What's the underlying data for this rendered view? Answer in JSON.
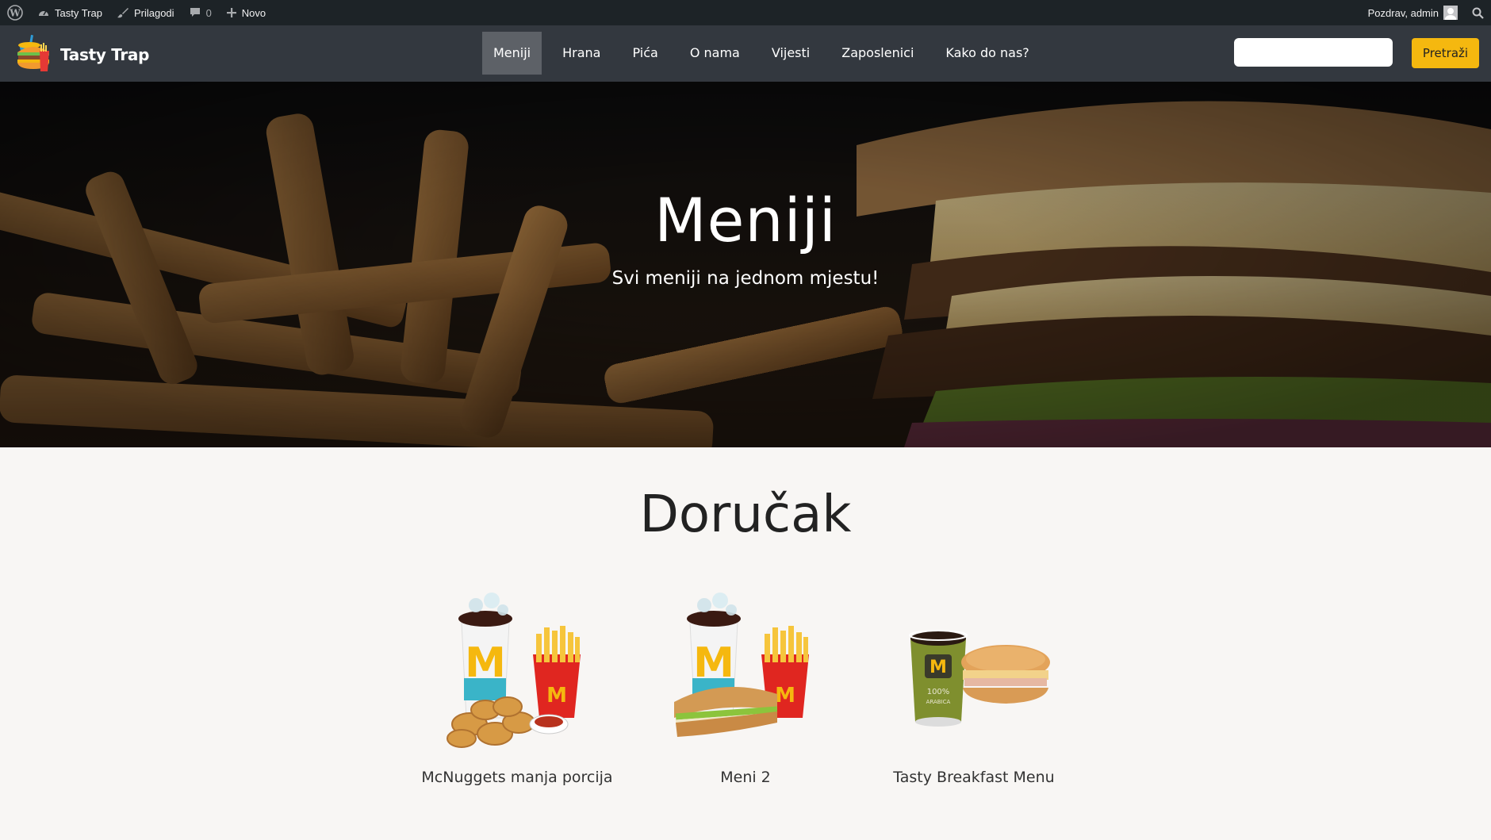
{
  "admin_bar": {
    "wp_logo_icon": "wordpress-icon",
    "site_name": "Tasty Trap",
    "customize": "Prilagodi",
    "comments_count": "0",
    "new": "Novo",
    "greeting": "Pozdrav, admin"
  },
  "header": {
    "brand_name": "Tasty Trap",
    "nav": [
      "Meniji",
      "Hrana",
      "Pića",
      "O nama",
      "Vijesti",
      "Zaposlenici",
      "Kako do nas?"
    ],
    "active_nav": "Meniji",
    "search_placeholder": "",
    "search_button": "Pretraži"
  },
  "hero": {
    "title": "Meniji",
    "subtitle": "Svi meniji na jednom mjestu!"
  },
  "section": {
    "title": "Doručak",
    "items": [
      {
        "name": "McNuggets manja porcija",
        "image": "nuggets-menu"
      },
      {
        "name": "Meni 2",
        "image": "sandwich-menu"
      },
      {
        "name": "Tasty Breakfast Menu",
        "image": "coffee-muffin-menu"
      }
    ]
  },
  "colors": {
    "admin_bar": "#1d2327",
    "header": "#33383f",
    "accent": "#f5b80f",
    "page_bg": "#f8f6f4"
  }
}
